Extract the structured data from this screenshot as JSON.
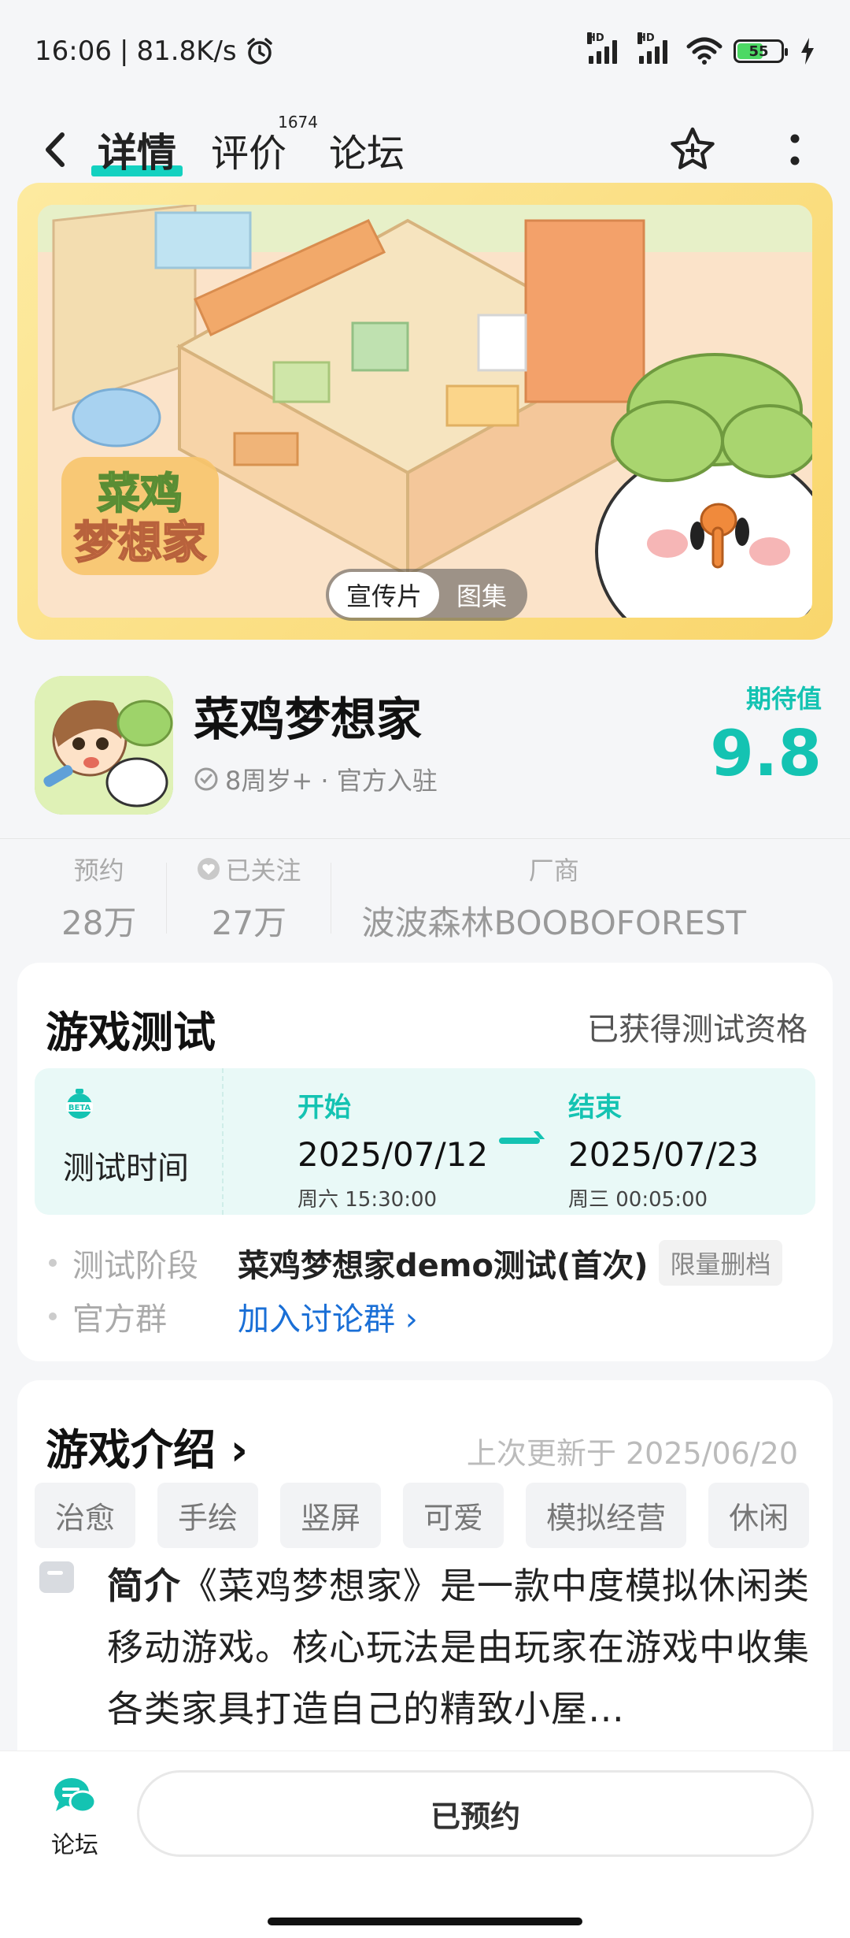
{
  "status_bar": {
    "time": "16:06",
    "speed": "81.8K/s",
    "battery": "55"
  },
  "nav": {
    "tab_detail": "详情",
    "tab_reviews": "评价",
    "reviews_count": "1674",
    "tab_forum": "论坛"
  },
  "banner": {
    "toggle_video": "宣传片",
    "toggle_gallery": "图集",
    "logo_line1": "菜鸡",
    "logo_line2": "梦想家"
  },
  "app": {
    "name": "菜鸡梦想家",
    "meta": "8周岁+ · 官方入驻",
    "score_label": "期待值",
    "score": "9.8"
  },
  "stats": {
    "reserve_label": "预约",
    "reserve_value": "28万",
    "follow_label": "已关注",
    "follow_value": "27万",
    "vendor_label": "厂商",
    "vendor_value": "波波森林BOOBOFOREST"
  },
  "test_card": {
    "title": "游戏测试",
    "status": "已获得测试资格",
    "time_label": "测试时间",
    "start_label": "开始",
    "start_date": "2025/07/12",
    "start_time": "周六  15:30:00",
    "end_label": "结束",
    "end_date": "2025/07/23",
    "end_time": "周三  00:05:00",
    "stage_key": "测试阶段",
    "stage_value": "菜鸡梦想家demo测试(首次)",
    "stage_tag": "限量删档",
    "group_key": "官方群",
    "group_value": "加入讨论群 ›"
  },
  "intro_card": {
    "title": "游戏介绍 ›",
    "updated": "上次更新于 2025/06/20",
    "tags": [
      "治愈",
      "手绘",
      "竖屏",
      "可爱",
      "模拟经营",
      "休闲"
    ],
    "intro_label": "简介",
    "intro_text": "《菜鸡梦想家》是一款中度模拟休闲类移动游戏。核心玩法是由玩家在游戏中收集各类家具打造自己的精致小屋…"
  },
  "bottom": {
    "forum_label": "论坛",
    "reserve_button": "已预约"
  }
}
